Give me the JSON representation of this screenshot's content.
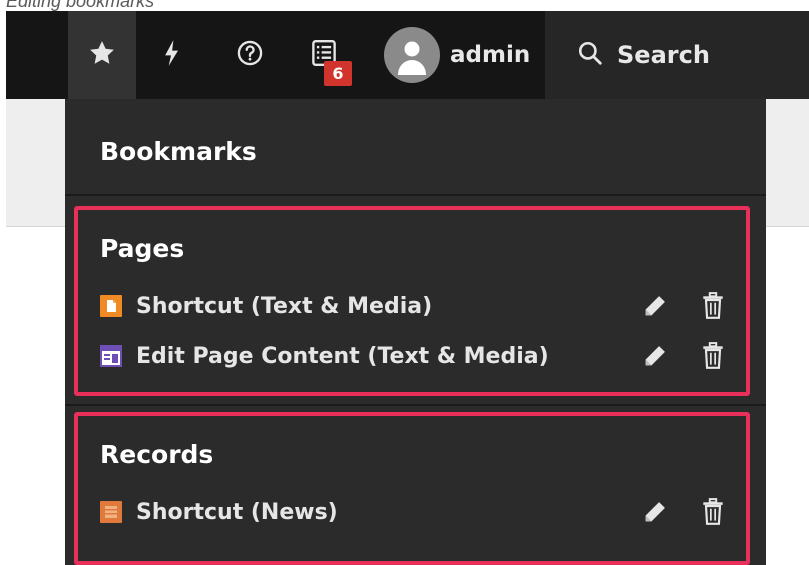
{
  "caption": "Editing bookmarks",
  "toolbar": {
    "notification_count": "6",
    "user_name": "admin",
    "search_label": "Search"
  },
  "dropdown": {
    "title": "Bookmarks",
    "groups": [
      {
        "title": "Pages",
        "items": [
          {
            "label": "Shortcut (Text & Media)",
            "icon": "page-shortcut-icon"
          },
          {
            "label": "Edit Page Content (Text & Media)",
            "icon": "page-content-icon"
          }
        ]
      },
      {
        "title": "Records",
        "items": [
          {
            "label": "Shortcut (News)",
            "icon": "record-shortcut-icon"
          }
        ]
      }
    ]
  },
  "colors": {
    "toolbar_bg": "#151515",
    "dropdown_bg": "#2b2b2b",
    "highlight_border": "#e8305a",
    "badge": "#d0342c",
    "page_icon_orange": "#f08a24",
    "record_icon_orange": "#e07a3c",
    "content_icon_purple": "#6d4fb5"
  }
}
